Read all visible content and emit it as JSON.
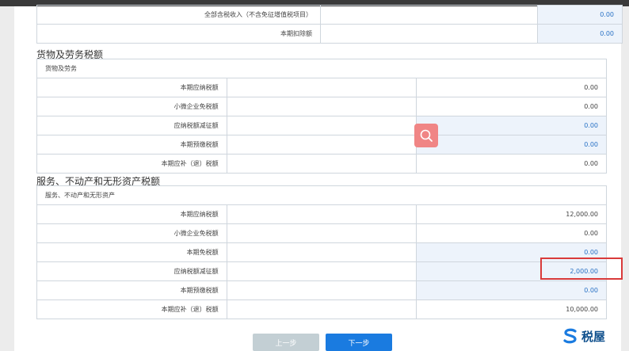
{
  "section_top": {
    "rows": [
      {
        "label": "全部含税收入（不含免征增值税项目）",
        "value": "0.00",
        "editable": true
      },
      {
        "label": "本期扣除额",
        "value": "0.00",
        "editable": true
      }
    ]
  },
  "goods_section": {
    "title": "货物及劳务税额",
    "subtitle": "货物及劳务",
    "rows": [
      {
        "label": "本期应纳税额",
        "value": "0.00",
        "editable": false
      },
      {
        "label": "小微企业免税额",
        "value": "0.00",
        "editable": false
      },
      {
        "label": "应纳税额减征额",
        "value": "0.00",
        "editable": true
      },
      {
        "label": "本期预缴税额",
        "value": "0.00",
        "editable": true
      },
      {
        "label": "本期应补（退）税额",
        "value": "0.00",
        "editable": false
      }
    ]
  },
  "service_section": {
    "title": "服务、不动产和无形资产税额",
    "subtitle": "服务、不动产和无形资产",
    "rows": [
      {
        "label": "本期应纳税额",
        "value": "12,000.00",
        "editable": false
      },
      {
        "label": "小微企业免税额",
        "value": "0.00",
        "editable": false
      },
      {
        "label": "本期免税额",
        "value": "0.00",
        "editable": true
      },
      {
        "label": "应纳税额减征额",
        "value": "2,000.00",
        "editable": true
      },
      {
        "label": "本期预缴税额",
        "value": "0.00",
        "editable": true
      },
      {
        "label": "本期应补（退）税额",
        "value": "10,000.00",
        "editable": false
      }
    ]
  },
  "buttons": {
    "prev": "上一步",
    "next": "下一步"
  },
  "logo": {
    "text": "税屋"
  },
  "floating_search_icon": "search-icon",
  "colors": {
    "accent": "#1a7be0",
    "highlight": "#d93a3a",
    "editable_bg": "#edf3fb"
  }
}
